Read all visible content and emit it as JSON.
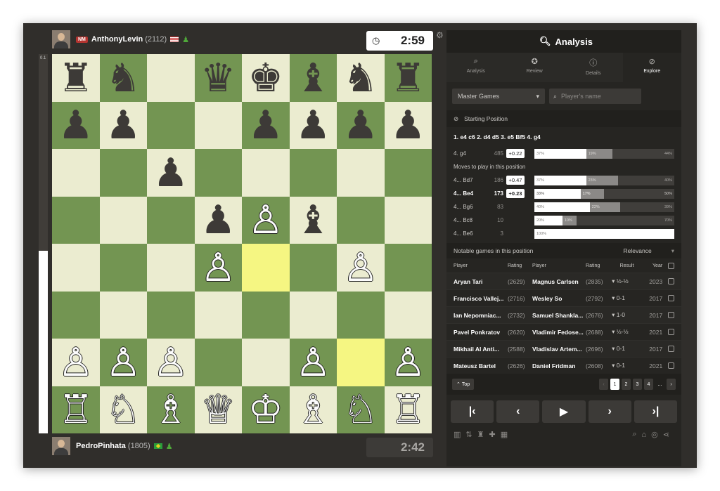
{
  "top_player": {
    "title": "NM",
    "name": "AnthonyLevin",
    "rating": "(2112)",
    "clock": "2:59"
  },
  "bottom_player": {
    "name": "PedroPinhata",
    "rating": "(1805)",
    "clock": "2:42"
  },
  "eval_label": "0.1",
  "board": [
    [
      "b:♜",
      "b:♞",
      "",
      "b:♛",
      "b:♚",
      "b:♝",
      "b:♞",
      "b:♜"
    ],
    [
      "b:♟",
      "b:♟",
      "",
      "",
      "b:♟",
      "b:♟",
      "b:♟",
      "b:♟"
    ],
    [
      "",
      "",
      "b:♟",
      "",
      "",
      "",
      "",
      ""
    ],
    [
      "",
      "",
      "",
      "b:♟",
      "w:♙",
      "b:♝",
      "",
      ""
    ],
    [
      "",
      "",
      "",
      "w:♙",
      "",
      "",
      "w:♙",
      ""
    ],
    [
      "",
      "",
      "",
      "",
      "",
      "",
      "",
      ""
    ],
    [
      "w:♙",
      "w:♙",
      "w:♙",
      "",
      "",
      "w:♙",
      "",
      "w:♙"
    ],
    [
      "w:♖",
      "w:♘",
      "w:♗",
      "w:♕",
      "w:♔",
      "w:♗",
      "w:♘",
      "w:♖"
    ]
  ],
  "highlight": [
    "e4",
    "g2"
  ],
  "panel": {
    "title": "Analysis",
    "tabs": [
      {
        "label": "Analysis",
        "icon": "analysis-icon"
      },
      {
        "label": "Review",
        "icon": "review-icon"
      },
      {
        "label": "Details",
        "icon": "details-icon"
      },
      {
        "label": "Explore",
        "icon": "explore-icon"
      }
    ],
    "database_select": "Master Games",
    "search_placeholder": "Player's name",
    "starting_position": "Starting Position",
    "pgn": "1. e4 c6 2. d4 d5 3. e5 Bf5 4. g4",
    "current_move": {
      "move": "4. g4",
      "count": "485",
      "eval": "+0.22",
      "white": "37%",
      "draw": "19%",
      "black": "44%"
    },
    "moves_label": "Moves to play in this position",
    "moves": [
      {
        "move": "4... Bd7",
        "count": "186",
        "eval": "+0.47",
        "white": "37%",
        "draw": "23%",
        "black": "40%"
      },
      {
        "move": "4... Be4",
        "count": "173",
        "eval": "+0.23",
        "white": "33%",
        "draw": "17%",
        "black": "50%"
      },
      {
        "move": "4... Bg6",
        "count": "83",
        "eval": "",
        "white": "40%",
        "draw": "22%",
        "black": "39%"
      },
      {
        "move": "4... Bc8",
        "count": "10",
        "eval": "",
        "white": "20%",
        "draw": "10%",
        "black": "70%"
      },
      {
        "move": "4... Be6",
        "count": "3",
        "eval": "",
        "white": "100%",
        "draw": "",
        "black": ""
      }
    ],
    "notable_label": "Notable games in this position",
    "sort_label": "Relevance",
    "game_headers": {
      "player": "Player",
      "rating": "Rating",
      "player2": "Player",
      "rating2": "Rating",
      "result": "Result",
      "year": "Year"
    },
    "games": [
      {
        "white": "Aryan Tari",
        "wr": "(2629)",
        "black": "Magnus Carlsen",
        "br": "(2835)",
        "result": "½-½",
        "year": "2023"
      },
      {
        "white": "Francisco Vallej...",
        "wr": "(2716)",
        "black": "Wesley So",
        "br": "(2792)",
        "result": "0-1",
        "year": "2017"
      },
      {
        "white": "Ian Nepomniac...",
        "wr": "(2732)",
        "black": "Samuel Shankla...",
        "br": "(2676)",
        "result": "1-0",
        "year": "2017"
      },
      {
        "white": "Pavel Ponkratov",
        "wr": "(2620)",
        "black": "Vladimir Fedose...",
        "br": "(2688)",
        "result": "½-½",
        "year": "2021"
      },
      {
        "white": "Mikhail Al Anti...",
        "wr": "(2588)",
        "black": "Vladislav Artem...",
        "br": "(2696)",
        "result": "0-1",
        "year": "2017"
      },
      {
        "white": "Mateusz Bartel",
        "wr": "(2626)",
        "black": "Daniel Fridman",
        "br": "(2608)",
        "result": "0-1",
        "year": "2021"
      }
    ],
    "top_label": "Top",
    "pages": [
      "1",
      "2",
      "3",
      "4",
      "..."
    ]
  }
}
